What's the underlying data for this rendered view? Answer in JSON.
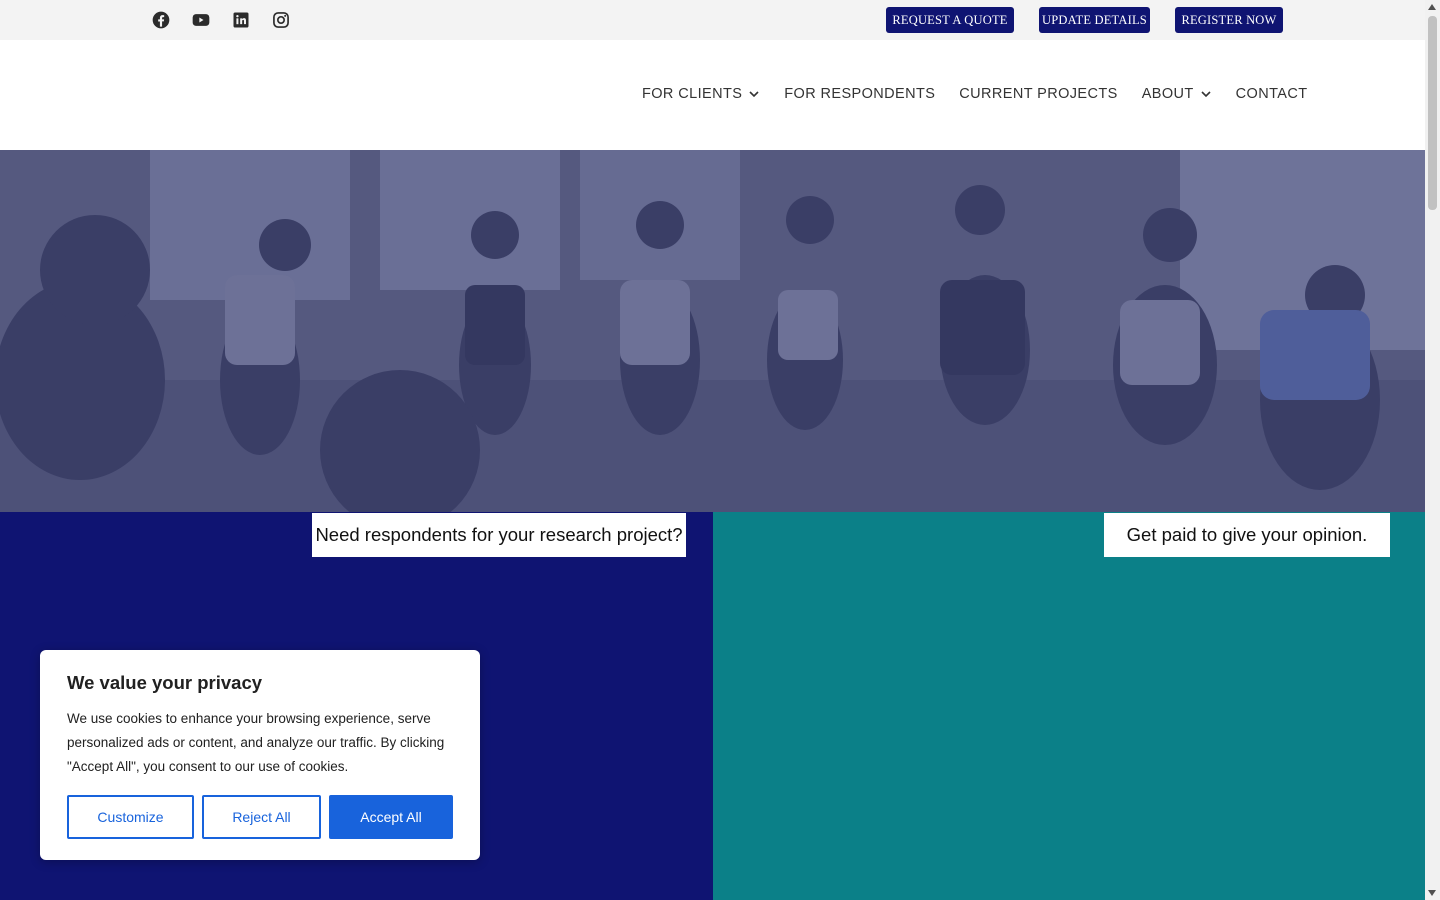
{
  "social": [
    {
      "name": "facebook-icon"
    },
    {
      "name": "youtube-icon"
    },
    {
      "name": "linkedin-icon"
    },
    {
      "name": "instagram-icon"
    }
  ],
  "top_buttons": {
    "quote": "REQUEST A QUOTE",
    "update": "UPDATE DETAILS",
    "register": "REGISTER NOW"
  },
  "nav": {
    "clients": "FOR CLIENTS",
    "respondents": "FOR RESPONDENTS",
    "projects": "CURRENT PROJECTS",
    "about": "ABOUT",
    "contact": "CONTACT"
  },
  "hero": {
    "image": "group-discussion-photo"
  },
  "panels": {
    "left_tag": "Need respondents for your research project?",
    "right_tag": "Get paid to give your opinion."
  },
  "cookie": {
    "title": "We value your privacy",
    "body": "We use cookies to enhance your browsing experience, serve personalized ads or content, and analyze our traffic. By clicking \"Accept All\", you consent to our use of cookies.",
    "customize": "Customize",
    "reject": "Reject All",
    "accept": "Accept All"
  },
  "colors": {
    "brand_navy": "#0f1472",
    "brand_teal": "#0b8088",
    "cookie_blue": "#1863dc"
  }
}
